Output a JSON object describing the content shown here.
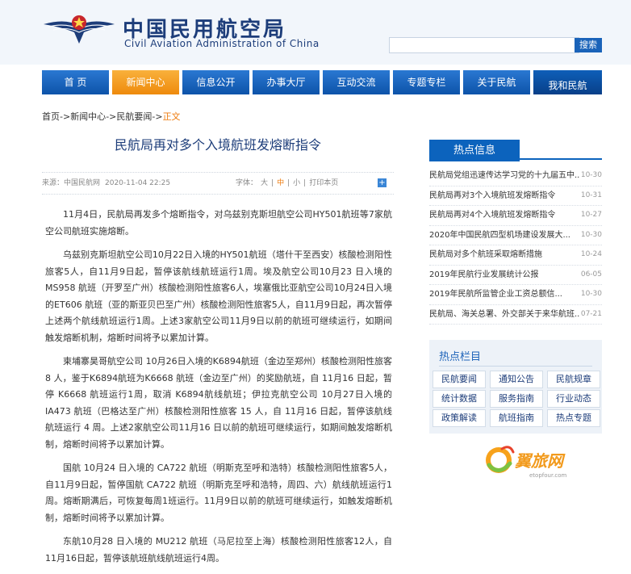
{
  "header": {
    "title_cn": "中国民用航空局",
    "title_en": "Civil Aviation Administration of China",
    "search_placeholder": "",
    "search_button": "搜索",
    "colors": {
      "primary": "#0c63bd",
      "accent": "#ee8a0c"
    }
  },
  "nav": {
    "items": [
      {
        "label": "首 页"
      },
      {
        "label": "新闻中心"
      },
      {
        "label": "信息公开"
      },
      {
        "label": "办事大厅"
      },
      {
        "label": "互动交流"
      },
      {
        "label": "专题专栏"
      },
      {
        "label": "关于民航"
      },
      {
        "label": "我和民航"
      }
    ],
    "active_index": 1
  },
  "breadcrumb": {
    "home": "首页",
    "sep": "->",
    "news": "新闻中心",
    "category": "民航要闻",
    "current": "正文"
  },
  "article": {
    "title": "民航局再对多个入境航班发熔断指令",
    "source": "来源：中国民航网",
    "date": "2020-11-04 22:25",
    "font_label": "字体：",
    "font_large": "大",
    "font_medium": "中",
    "font_small": "小",
    "sep": "|",
    "print": "打印本页",
    "paragraphs": [
      "11月4日，民航局再发多个熔断指令，对乌兹别克斯坦航空公司HY501航班等7家航空公司航班实施熔断。",
      "乌兹别克斯坦航空公司10月22日入境的HY501航班（塔什干至西安）核酸检测阳性旅客5人，自11月9日起，暂停该航线航班运行1周。埃及航空公司10月23 日入境的MS958 航班（开罗至广州）核酸检测阳性旅客6人，埃塞俄比亚航空公司10月24日入境的ET606 航班（亚的斯亚贝巴至广州）核酸检测阳性旅客5人，自11月9日起，再次暂停上述两个航线航班运行1周。上述3家航空公司11月9日以前的航班可继续运行，如期间触发熔断机制，熔断时间将予以累加计算。",
      "柬埔寨昊哥航空公司 10月26日入境的K6894航班（金边至郑州）核酸检测阳性旅客 8 人，鉴于K6894航班为K6668 航班（金边至广州）的奖励航班，自 11月16 日起，暂停 K6668 航班运行1周，取消 K6894航线航班；伊拉克航空公司 10月27日入境的 IA473 航班（巴格达至广州）核酸检测阳性旅客 15 人，自 11月16 日起，暂停该航线航班运行 4 周。上述2家航空公司11月16 日以前的航班可继续运行，如期间触发熔断机制，熔断时间将予以累加计算。",
      "国航 10月24 日入境的 CA722 航班（明斯克至呼和浩特）核酸检测阳性旅客5人，自11月9日起，暂停国航 CA722 航班（明斯克至呼和浩特，周四、六）航线航班运行1周。熔断期满后，可恢复每周1班运行。11月9日以前的航班可继续运行，如触发熔断机制，熔断时间将予以累加计算。",
      "东航10月28 日入境的 MU212 航班（马尼拉至上海）核酸检测阳性旅客12人，自11月16日起，暂停该航班航线航班运行4周。"
    ]
  },
  "sidebar": {
    "hot_title": "热点信息",
    "hot_items": [
      {
        "title": "民航局党组迅速传达学习党的十九届五中...",
        "date": "10-30"
      },
      {
        "title": "民航局再对3个入境航班发熔断指令",
        "date": "10-31"
      },
      {
        "title": "民航局再对4个入境航班发熔断指令",
        "date": "10-27"
      },
      {
        "title": "2020年中国民航四型机场建设发展大...",
        "date": "10-30"
      },
      {
        "title": "民航局对多个航班采取熔断措施",
        "date": "10-24"
      },
      {
        "title": "2019年民航行业发展统计公报",
        "date": "06-05"
      },
      {
        "title": "2019年民航所监管企业工资总额信...",
        "date": "10-30"
      },
      {
        "title": "民航局、海关总署、外交部关于来华航班...",
        "date": "07-21"
      }
    ],
    "columns_title": "热点栏目",
    "columns": [
      "民航要闻",
      "通知公告",
      "民航规章",
      "统计数据",
      "服务指南",
      "行业动态",
      "政策解读",
      "航班指南",
      "热点专题"
    ],
    "brand_cn": "翼旅网",
    "brand_url": "etopfour.com"
  }
}
